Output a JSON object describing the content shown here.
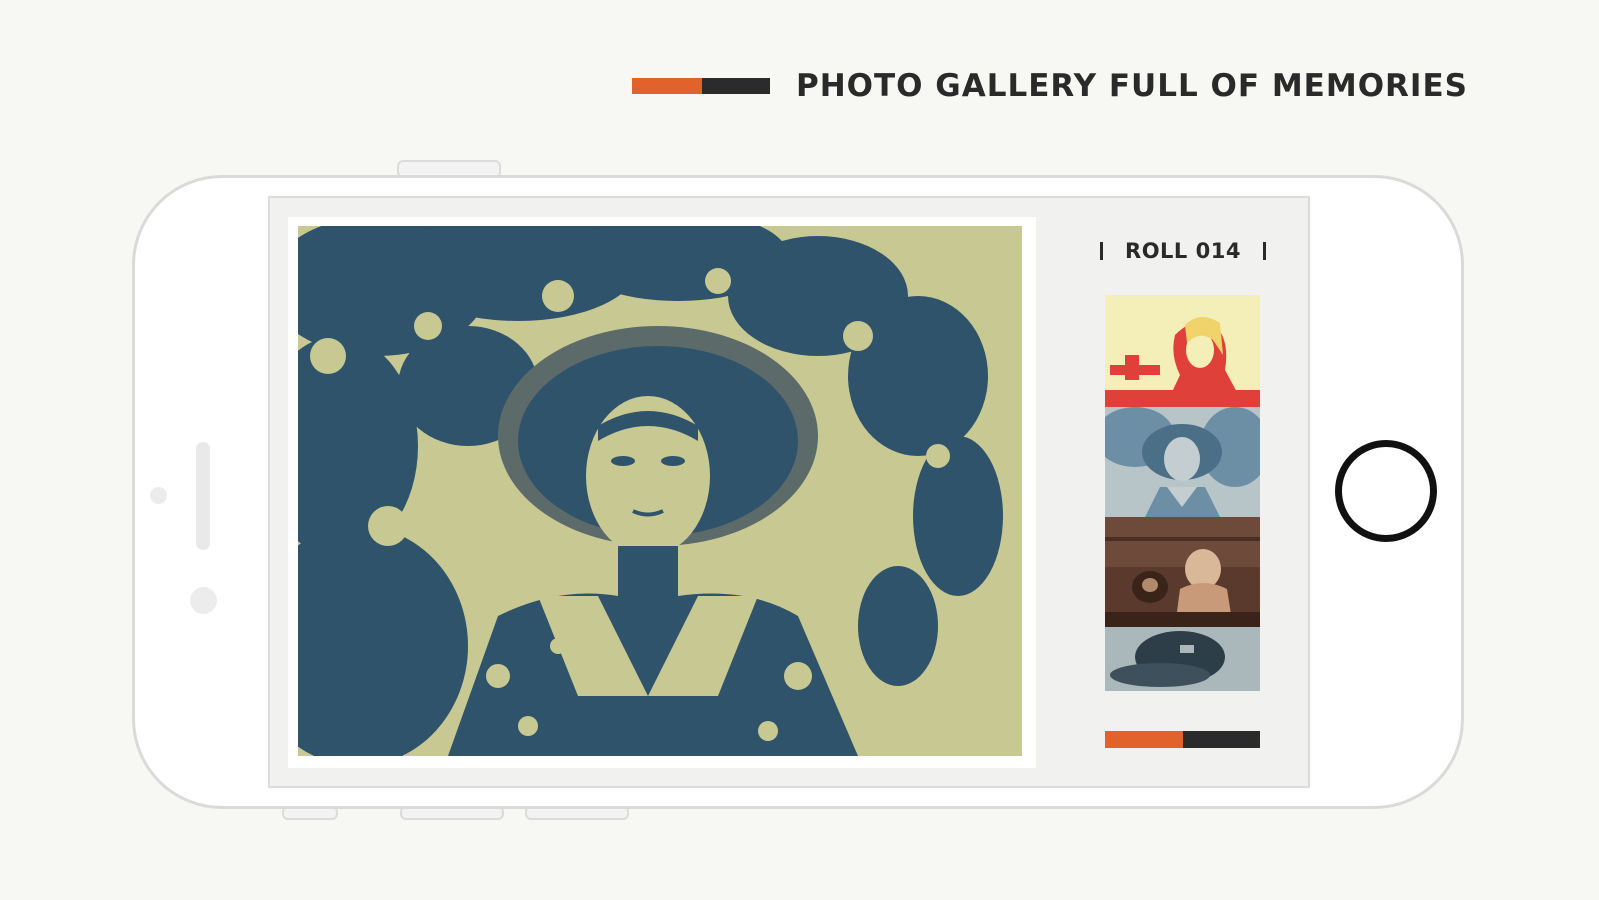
{
  "header": {
    "title": "PHOTO GALLERY FULL OF MEMORIES"
  },
  "sidebar": {
    "roll_label": "ROLL 014",
    "thumbnails": [
      {
        "name": "thumbnail-woman-drinking"
      },
      {
        "name": "thumbnail-woman-in-hat"
      },
      {
        "name": "thumbnail-child-with-dog"
      },
      {
        "name": "thumbnail-cap"
      }
    ]
  },
  "colors": {
    "accent_orange": "#e2622c",
    "accent_dark": "#2b2b2b",
    "duotone_blue": "#2f536b",
    "duotone_cream": "#c8c992",
    "thumb_red": "#e0403a",
    "thumb_cream": "#f4efb8",
    "thumb_brown": "#5a3a2c"
  },
  "icons": {
    "home_button": "home-button-ring"
  }
}
